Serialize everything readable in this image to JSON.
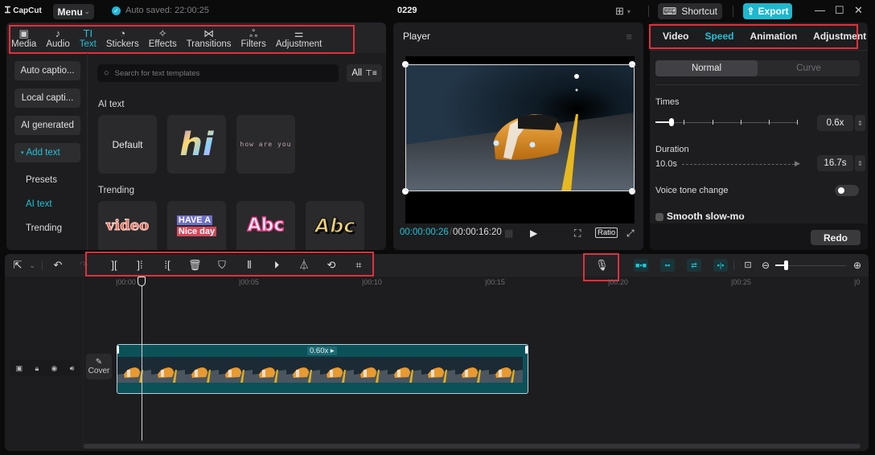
{
  "app": {
    "logo": "CapCut",
    "menu_label": "Menu",
    "autosave": "Auto saved: 22:00:25",
    "project_title": "0229",
    "shortcut_label": "Shortcut",
    "export_label": "Export"
  },
  "categories": [
    {
      "label": "Media",
      "icon": "media-icon",
      "glyph": "▣"
    },
    {
      "label": "Audio",
      "icon": "audio-icon",
      "glyph": "♪"
    },
    {
      "label": "Text",
      "icon": "text-icon",
      "glyph": "TI",
      "active": true
    },
    {
      "label": "Stickers",
      "icon": "stickers-icon",
      "glyph": "◔"
    },
    {
      "label": "Effects",
      "icon": "effects-icon",
      "glyph": "✧"
    },
    {
      "label": "Transitions",
      "icon": "transitions-icon",
      "glyph": "⋈"
    },
    {
      "label": "Filters",
      "icon": "filters-icon",
      "glyph": "ஃ"
    },
    {
      "label": "Adjustment",
      "icon": "adjustment-icon",
      "glyph": "⚌"
    }
  ],
  "text_sidebar": {
    "buttons": [
      "Auto captio...",
      "Local capti...",
      "AI generated",
      "Add text"
    ],
    "items": [
      "Presets",
      "AI text",
      "Trending"
    ],
    "active_item": "AI text"
  },
  "text_content": {
    "search_placeholder": "Search for text templates",
    "filter_label": "All",
    "ai_text_heading": "AI text",
    "ai_tiles": [
      "Default",
      "hi",
      "how are you"
    ],
    "trending_heading": "Trending",
    "trending_tiles": [
      "video",
      "HAVE A",
      "Nice day",
      "Abc",
      "Abc"
    ]
  },
  "player": {
    "title": "Player",
    "current_time": "00:00:00:26",
    "total_time": "00:00:16:20",
    "ratio_label": "Ratio"
  },
  "inspector": {
    "tabs": [
      "Video",
      "Speed",
      "Animation",
      "Adjustment"
    ],
    "active_tab": "Speed",
    "modes": [
      "Normal",
      "Curve"
    ],
    "active_mode": "Normal",
    "times_label": "Times",
    "times_value": "0.6x",
    "times_slider_fraction": 0.1,
    "duration_label": "Duration",
    "duration_original": "10.0s",
    "duration_value": "16.7s",
    "voice_tone_label": "Voice tone change",
    "voice_tone_on": false,
    "smooth_label": "Smooth slow-mo",
    "redo_label": "Redo"
  },
  "timeline": {
    "ruler_labels": [
      "00:00",
      "00:05",
      "00:10",
      "00:15",
      "00:20",
      "00:25",
      "0"
    ],
    "cover_label": "Cover",
    "clip_speed_label": "0.60x",
    "zoom_fraction": 0.08
  }
}
